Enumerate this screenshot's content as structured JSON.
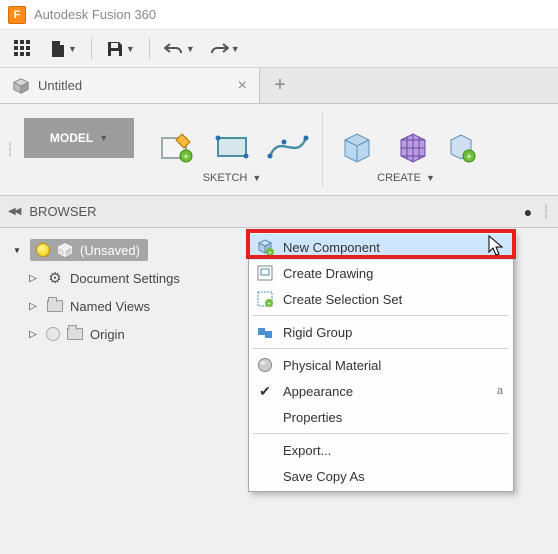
{
  "app": {
    "title": "Autodesk Fusion 360"
  },
  "tab": {
    "title": "Untitled"
  },
  "workspace": {
    "label": "MODEL"
  },
  "ribbon": {
    "sketch_label": "SKETCH",
    "create_label": "CREATE"
  },
  "browser": {
    "header": "BROWSER",
    "root_label": "(Unsaved)",
    "items": [
      {
        "label": "Document Settings"
      },
      {
        "label": "Named Views"
      },
      {
        "label": "Origin"
      }
    ]
  },
  "context_menu": {
    "items": [
      {
        "label": "New Component",
        "highlighted": true
      },
      {
        "label": "Create Drawing"
      },
      {
        "label": "Create Selection Set"
      },
      {
        "label": "Rigid Group"
      },
      {
        "label": "Physical Material"
      },
      {
        "label": "Appearance",
        "shortcut": "a"
      },
      {
        "label": "Properties"
      },
      {
        "label": "Export..."
      },
      {
        "label": "Save Copy As"
      }
    ]
  }
}
